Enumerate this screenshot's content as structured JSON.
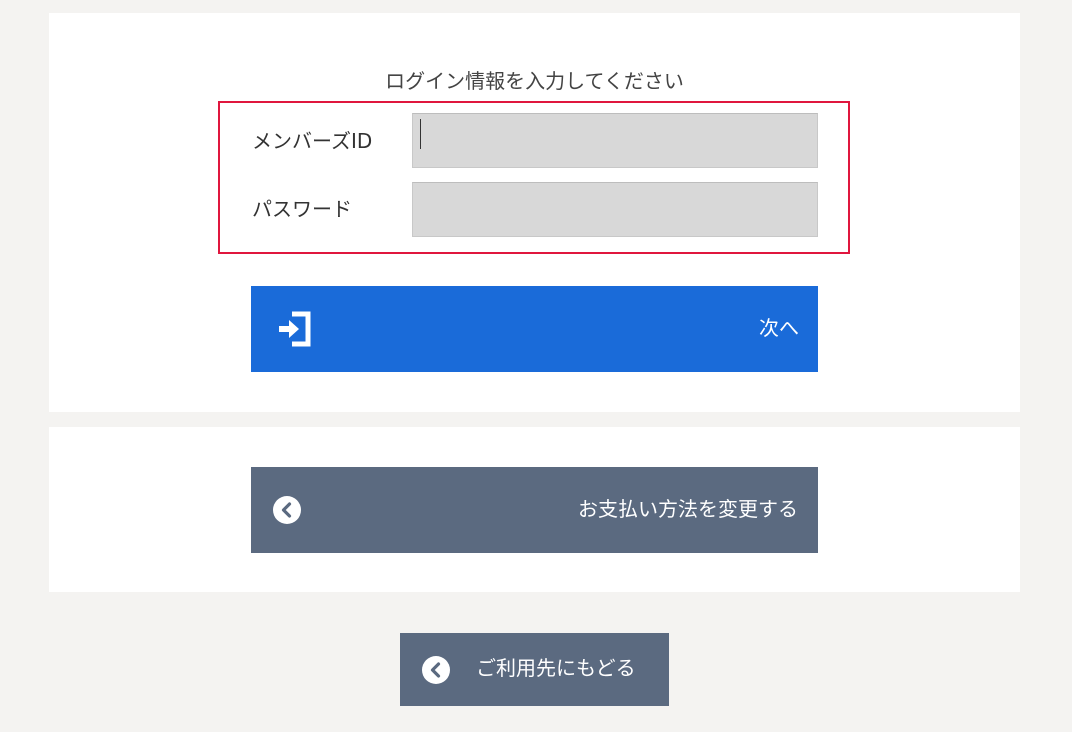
{
  "login": {
    "instruction": "ログイン情報を入力してください",
    "member_id": {
      "label": "メンバーズID",
      "value": "",
      "placeholder": ""
    },
    "password": {
      "label": "パスワード",
      "value": "",
      "placeholder": ""
    },
    "next_button": {
      "label": "次へ",
      "icon": "login-icon"
    }
  },
  "payment": {
    "change_button": {
      "label": "お支払い方法を変更する",
      "icon": "circle-chevron-left-icon"
    }
  },
  "footer": {
    "return_button": {
      "label": "ご利用先にもどる",
      "icon": "circle-chevron-left-icon"
    }
  },
  "colors": {
    "page_background": "#f4f3f1",
    "panel_background": "#ffffff",
    "primary_button": "#1a6bd9",
    "secondary_button": "#5b6a80",
    "focus_outline": "#e0163e",
    "input_background": "#d8d8d8"
  }
}
